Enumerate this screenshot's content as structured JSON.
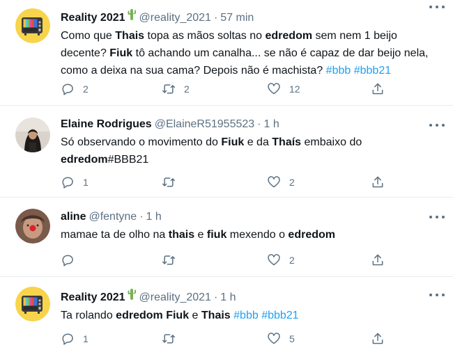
{
  "tweets": [
    {
      "name": "Reality 2021",
      "handle": "@reality_2021",
      "time": "57 min",
      "avatar": "tv-icon",
      "text_parts": [
        {
          "t": "Como que ",
          "s": "n"
        },
        {
          "t": "Thais",
          "s": "b"
        },
        {
          "t": " topa as mãos soltas no ",
          "s": "n"
        },
        {
          "t": "edredom",
          "s": "b"
        },
        {
          "t": " sem nem 1 beijo decente? ",
          "s": "n"
        },
        {
          "t": "Fiuk",
          "s": "b"
        },
        {
          "t": " tô achando um canalha... se não é capaz de dar beijo nela, como a deixa na sua cama? Depois não é machista? ",
          "s": "n"
        },
        {
          "t": "#bbb",
          "s": "h"
        },
        {
          "t": " ",
          "s": "n"
        },
        {
          "t": "#bbb21",
          "s": "h"
        }
      ],
      "replies": "2",
      "retweets": "2",
      "likes": "12"
    },
    {
      "name": "Elaine Rodrigues",
      "handle": "@ElaineR51955523",
      "time": "1 h",
      "avatar": "user-photo",
      "text_parts": [
        {
          "t": "Só observando o movimento do ",
          "s": "n"
        },
        {
          "t": "Fiuk",
          "s": "b"
        },
        {
          "t": " e da ",
          "s": "n"
        },
        {
          "t": "Thaís",
          "s": "b"
        },
        {
          "t": " embaixo do ",
          "s": "n"
        },
        {
          "t": "edredom",
          "s": "b"
        },
        {
          "t": "#BBB21",
          "s": "n"
        }
      ],
      "replies": "1",
      "retweets": "",
      "likes": "2"
    },
    {
      "name": "aline",
      "handle": "@fentyne",
      "time": "1 h",
      "avatar": "user-photo",
      "text_parts": [
        {
          "t": "mamae ta de olho na ",
          "s": "n"
        },
        {
          "t": "thais",
          "s": "b"
        },
        {
          "t": " e ",
          "s": "n"
        },
        {
          "t": "fiuk",
          "s": "b"
        },
        {
          "t": " mexendo o ",
          "s": "n"
        },
        {
          "t": "edredom",
          "s": "b"
        }
      ],
      "replies": "",
      "retweets": "",
      "likes": "2"
    },
    {
      "name": "Reality 2021",
      "handle": "@reality_2021",
      "time": "1 h",
      "avatar": "tv-icon",
      "text_parts": [
        {
          "t": "Ta rolando ",
          "s": "n"
        },
        {
          "t": "edredom",
          "s": "b"
        },
        {
          "t": " ",
          "s": "n"
        },
        {
          "t": "Fiuk",
          "s": "b"
        },
        {
          "t": " e ",
          "s": "n"
        },
        {
          "t": "Thais",
          "s": "b"
        },
        {
          "t": " ",
          "s": "n"
        },
        {
          "t": "#bbb",
          "s": "h"
        },
        {
          "t": " ",
          "s": "n"
        },
        {
          "t": "#bbb21",
          "s": "h"
        }
      ],
      "replies": "1",
      "retweets": "",
      "likes": "5"
    }
  ],
  "separator": "·",
  "colors": {
    "text": "#0f1419",
    "muted": "#5b7083",
    "link": "#1da1f2",
    "divider": "#e6ecf0"
  }
}
